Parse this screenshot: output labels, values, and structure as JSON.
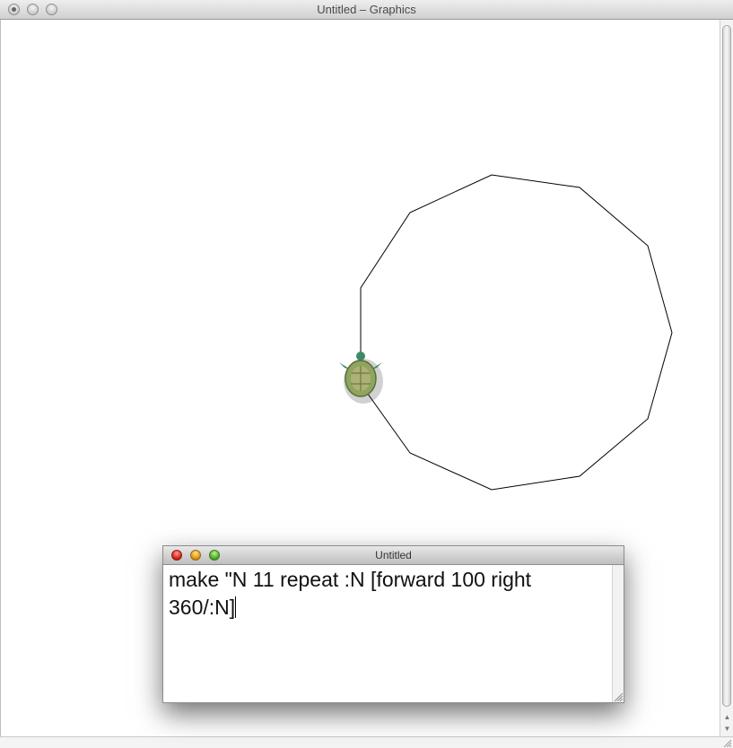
{
  "main_window": {
    "title": "Untitled – Graphics"
  },
  "drawing": {
    "shape": "11-sided polygon",
    "stroke_color": "#000000",
    "turtle_icon": "turtle-icon"
  },
  "command_window": {
    "title": "Untitled",
    "code": "make \"N 11 repeat :N [forward 100 right\n360/:N]"
  },
  "colors": {
    "close_button": "#d6281f",
    "minimize_button": "#e09a15",
    "zoom_button": "#53b12a"
  }
}
